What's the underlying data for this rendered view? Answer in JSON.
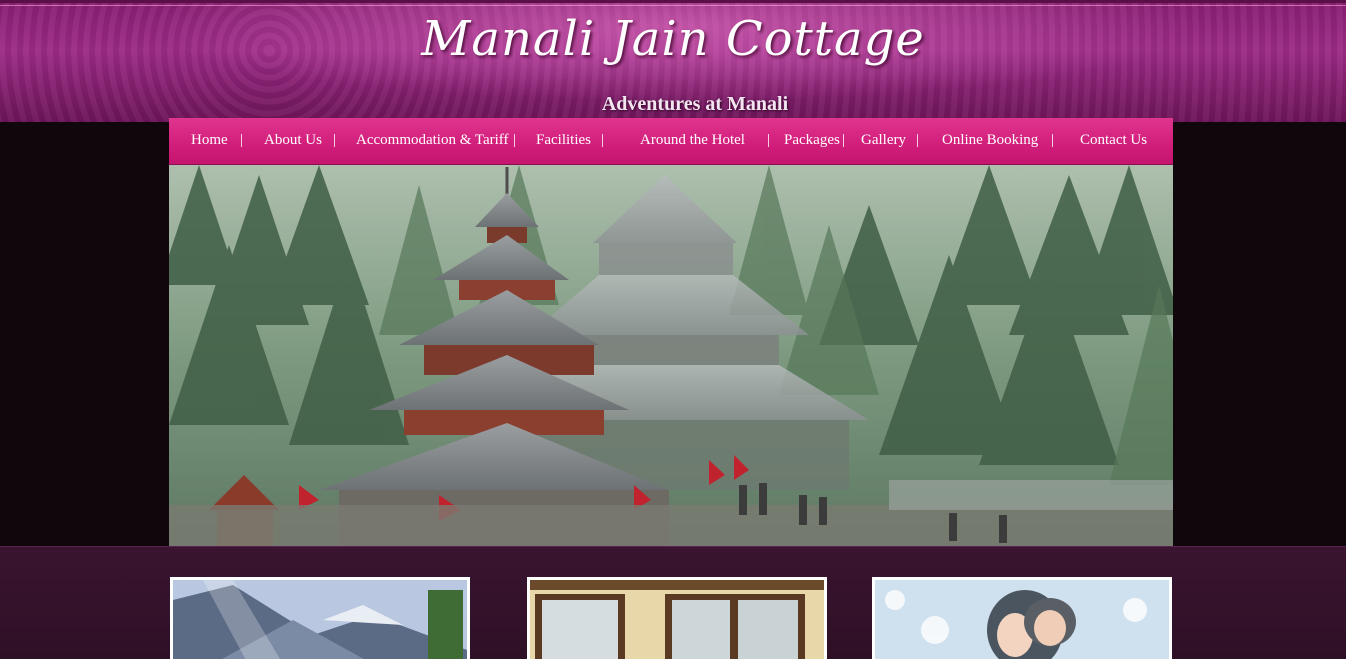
{
  "header": {
    "title": "Manali Jain Cottage",
    "subtitle": "Adventures at Manali"
  },
  "nav": {
    "items": [
      {
        "label": "Home"
      },
      {
        "label": "About Us"
      },
      {
        "label": "Accommodation & Tariff"
      },
      {
        "label": "Facilities"
      },
      {
        "label": "Around the Hotel"
      },
      {
        "label": "Packages"
      },
      {
        "label": "Gallery"
      },
      {
        "label": "Online Booking"
      },
      {
        "label": "Contact Us"
      }
    ],
    "separator": "|"
  },
  "hero": {
    "image": "hadimba-temple-forest-photo"
  },
  "thumbnails": [
    {
      "image": "mountain-valley-photo"
    },
    {
      "image": "cottage-room-window-photo"
    },
    {
      "image": "snow-couple-photo"
    }
  ],
  "colors": {
    "header": "#9c2b86",
    "nav": "#d21f7c",
    "background": "#0f070c",
    "lower": "#3a1430"
  }
}
